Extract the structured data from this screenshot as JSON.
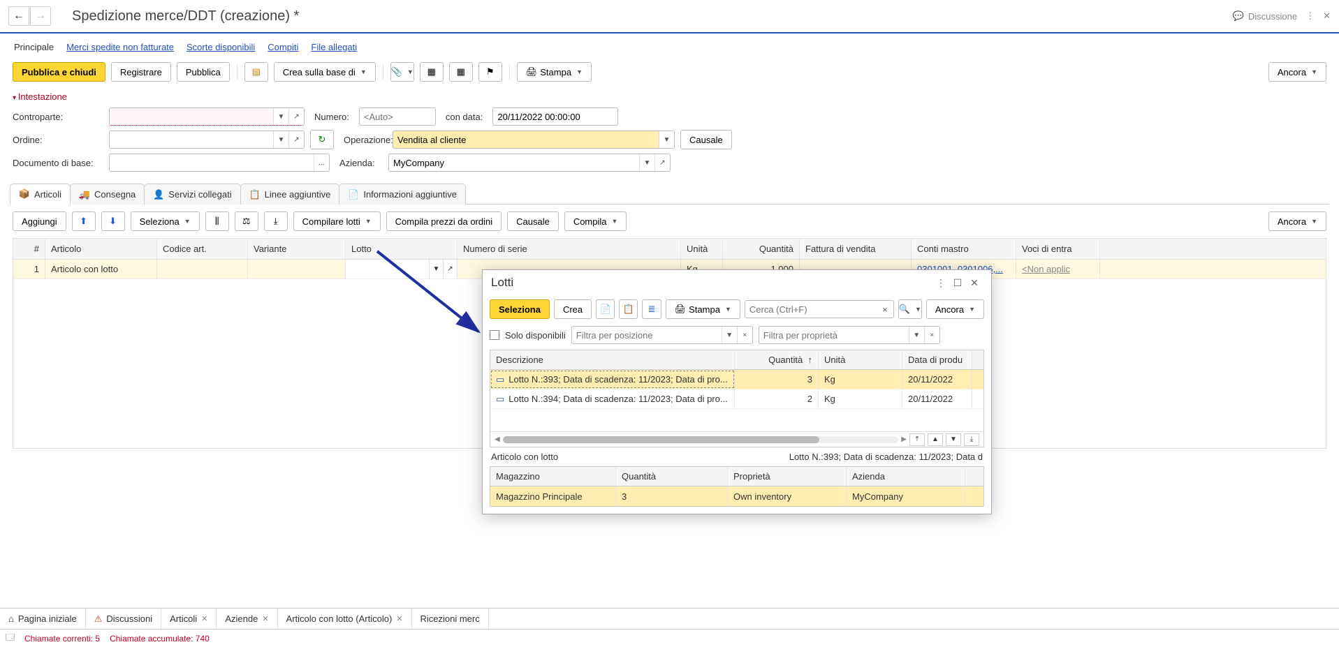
{
  "title": "Spedizione merce/DDT (creazione) *",
  "discussion": "Discussione",
  "main_tabs": [
    "Principale",
    "Merci spedite non fatturate",
    "Scorte disponibili",
    "Compiti",
    "File allegati"
  ],
  "toolbar": {
    "publish_close": "Pubblica e chiudi",
    "register": "Registrare",
    "publish": "Pubblica",
    "create_based": "Crea sulla base di",
    "print": "Stampa",
    "more": "Ancora"
  },
  "section_header": "Intestazione",
  "form": {
    "counterparty_label": "Controparte:",
    "order_label": "Ordine:",
    "basedoc_label": "Documento di base:",
    "number_label": "Numero:",
    "number_placeholder": "<Auto>",
    "withdate_label": "con data:",
    "withdate_value": "20/11/2022 00:00:00",
    "operation_label": "Operazione:",
    "operation_value": "Vendita al cliente",
    "reason": "Causale",
    "company_label": "Azienda:",
    "company_value": "MyCompany"
  },
  "subtabs": [
    "Articoli",
    "Consegna",
    "Servizi collegati",
    "Linee aggiuntive",
    "Informazioni aggiuntive"
  ],
  "subtoolbar": {
    "add": "Aggiungi",
    "select": "Seleziona",
    "compile_lots": "Compilare lotti",
    "compile_prices": "Compila prezzi da ordini",
    "reason": "Causale",
    "compile": "Compila",
    "more": "Ancora"
  },
  "grid": {
    "headers": {
      "num": "#",
      "articolo": "Articolo",
      "codice": "Codice art.",
      "variante": "Variante",
      "lotto": "Lotto",
      "serie": "Numero di serie",
      "unita": "Unità",
      "quantita": "Quantità",
      "fattura": "Fattura di vendita",
      "conti": "Conti mastro",
      "voci": "Voci di entra"
    },
    "row": {
      "num": "1",
      "articolo": "Articolo con lotto",
      "unita": "Kg",
      "quantita": "1,000",
      "conti": "0301001, 0301006,...",
      "voci": "<Non applic"
    }
  },
  "popup": {
    "title": "Lotti",
    "toolbar": {
      "select": "Seleziona",
      "create": "Crea",
      "print": "Stampa",
      "more": "Ancora",
      "search_placeholder": "Cerca (Ctrl+F)"
    },
    "filter": {
      "only_available": "Solo disponibili",
      "pos_placeholder": "Filtra per posizione",
      "prop_placeholder": "Filtra per proprietà"
    },
    "grid": {
      "headers": {
        "desc": "Descrizione",
        "qty": "Quantità",
        "unit": "Unità",
        "date": "Data di produ"
      },
      "rows": [
        {
          "desc": "Lotto N.:393; Data di scadenza: 11/2023; Data di pro...",
          "qty": "3",
          "unit": "Kg",
          "date": "20/11/2022"
        },
        {
          "desc": "Lotto N.:394; Data di scadenza: 11/2023; Data di pro...",
          "qty": "2",
          "unit": "Kg",
          "date": "20/11/2022"
        }
      ]
    },
    "status_left": "Articolo con lotto",
    "status_right": "Lotto N.:393; Data di scadenza: 11/2023; Data d",
    "grid2": {
      "headers": {
        "mag": "Magazzino",
        "qty": "Quantità",
        "prop": "Proprietà",
        "az": "Azienda"
      },
      "row": {
        "mag": "Magazzino Principale",
        "qty": "3",
        "prop": "Own inventory",
        "az": "MyCompany"
      }
    }
  },
  "footer_tabs": [
    {
      "label": "Pagina iniziale",
      "icon": "home",
      "closable": false
    },
    {
      "label": "Discussioni",
      "icon": "alert",
      "closable": false
    },
    {
      "label": "Articoli",
      "closable": true
    },
    {
      "label": "Aziende",
      "closable": true
    },
    {
      "label": "Articolo con lotto (Articolo)",
      "closable": true
    },
    {
      "label": "Ricezioni merc",
      "closable": false
    }
  ],
  "status": {
    "current": "Chiamate correnti: 5",
    "accum": "Chiamate accumulate: 740"
  }
}
